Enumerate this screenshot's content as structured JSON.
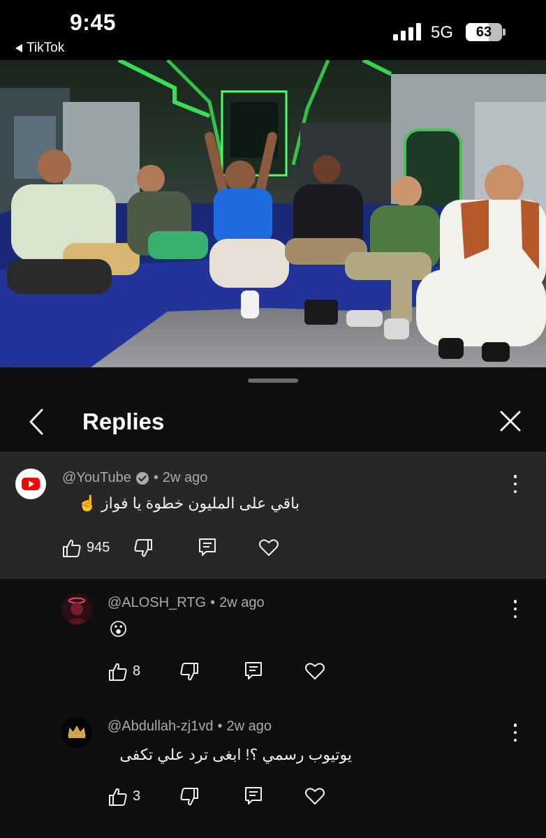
{
  "status_bar": {
    "time": "9:45",
    "back_app": "TikTok",
    "network": "5G",
    "battery": "63",
    "battery_level": 0.63
  },
  "video": {
    "description_icon": "video-frame"
  },
  "replies_panel": {
    "title": "Replies"
  },
  "comments": [
    {
      "author": "@YouTube",
      "verified": true,
      "time": "2w ago",
      "text": "باقي على المليون خطوة يا فواز ☝️",
      "likes": "945",
      "avatar_icon": "youtube-logo-icon"
    },
    {
      "author": "@ALOSH_RTG",
      "time": "2w ago",
      "text": "😮",
      "likes": "8",
      "avatar_icon": "alosh-avatar"
    },
    {
      "author": "@Abdullah-zj1vd",
      "time": "2w ago",
      "text": "يوتيوب رسمي ؟! ابغى ترد علي تكفى",
      "likes": "3",
      "avatar_icon": "crown-avatar"
    }
  ],
  "separator": "•",
  "colors": {
    "background": "#0f0f0f",
    "highlighted_comment": "#272727",
    "youtube_red": "#ff0000",
    "secondary_text": "#aaaaaa"
  }
}
